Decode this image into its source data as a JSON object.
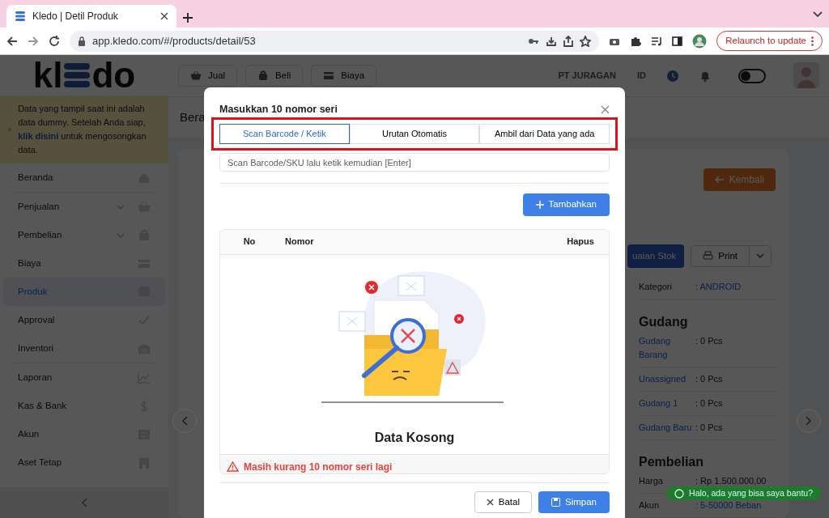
{
  "browser": {
    "tab_title": "Kledo | Detil Produk",
    "url": "app.kledo.com/#/products/detail/53",
    "relaunch": "Relaunch to update"
  },
  "logo": {
    "left": "kl",
    "right": "do"
  },
  "notice": {
    "before": "Data yang tampil saat ini adalah data dummy. Setelah Anda siap,",
    "link": "klik disini",
    "after": "untuk mengosongkan data."
  },
  "sidebar": {
    "groups": [
      [
        {
          "label": "Beranda",
          "expandable": false,
          "selected": false
        }
      ],
      [
        {
          "label": "Penjualan",
          "expandable": true,
          "selected": false
        },
        {
          "label": "Pembelian",
          "expandable": true,
          "selected": false
        },
        {
          "label": "Biaya",
          "expandable": false,
          "selected": false
        },
        {
          "label": "Produk",
          "expandable": false,
          "selected": true
        },
        {
          "label": "Approval",
          "expandable": false,
          "selected": false
        },
        {
          "label": "Inventori",
          "expandable": false,
          "selected": false
        }
      ],
      [
        {
          "label": "Laporan",
          "expandable": false,
          "selected": false
        },
        {
          "label": "Kas & Bank",
          "expandable": false,
          "selected": false
        },
        {
          "label": "Akun",
          "expandable": false,
          "selected": false
        },
        {
          "label": "Aset Tetap",
          "expandable": false,
          "selected": false
        }
      ]
    ]
  },
  "header": {
    "buttons": [
      "Jual",
      "Beli",
      "Biaya"
    ],
    "company": "PT JURAGAN",
    "language": "ID",
    "dark_mode": false
  },
  "breadcrumb": "Bera",
  "page": {
    "back_button": "Kembali",
    "stock_button": "uaian Stok",
    "print_button": "Print",
    "category": {
      "label": "Kategori",
      "value": ": ANDROID"
    },
    "sections": [
      {
        "title": "Gudang",
        "rows": [
          {
            "label": "Gudang Barang",
            "value": ": 0 Pcs"
          },
          {
            "label": "Unassigned",
            "value": ": 0 Pcs"
          },
          {
            "label": "Gudang 1",
            "value": ": 0 Pcs"
          },
          {
            "label": "Gudang Baru",
            "value": ": 0 Pcs"
          }
        ]
      },
      {
        "title": "Pembelian",
        "rows": [
          {
            "label": "Harga",
            "value": ": Rp 1.500.000,00"
          },
          {
            "label": "Akun",
            "value": ": 5-50000 Beban"
          }
        ]
      }
    ]
  },
  "chat": "Halo, ada yang bisa saya bantu?",
  "modal": {
    "title": "Masukkan 10 nomor seri",
    "tabs": [
      {
        "label": "Scan Barcode / Ketik",
        "selected": true
      },
      {
        "label": "Urutan Otomatis",
        "selected": false
      },
      {
        "label": "Ambil dari Data yang ada",
        "selected": false
      }
    ],
    "search": {
      "placeholder": "Scan Barcode/SKU lalu ketik kemudian [Enter]"
    },
    "add_button": "Tambahkan",
    "columns": [
      "No",
      "Nomor",
      "Hapus"
    ],
    "empty": "Data Kosong",
    "warning": "Masih kurang 10 nomor seri lagi",
    "cancel_button": "Batal",
    "save_button": "Simpan"
  }
}
